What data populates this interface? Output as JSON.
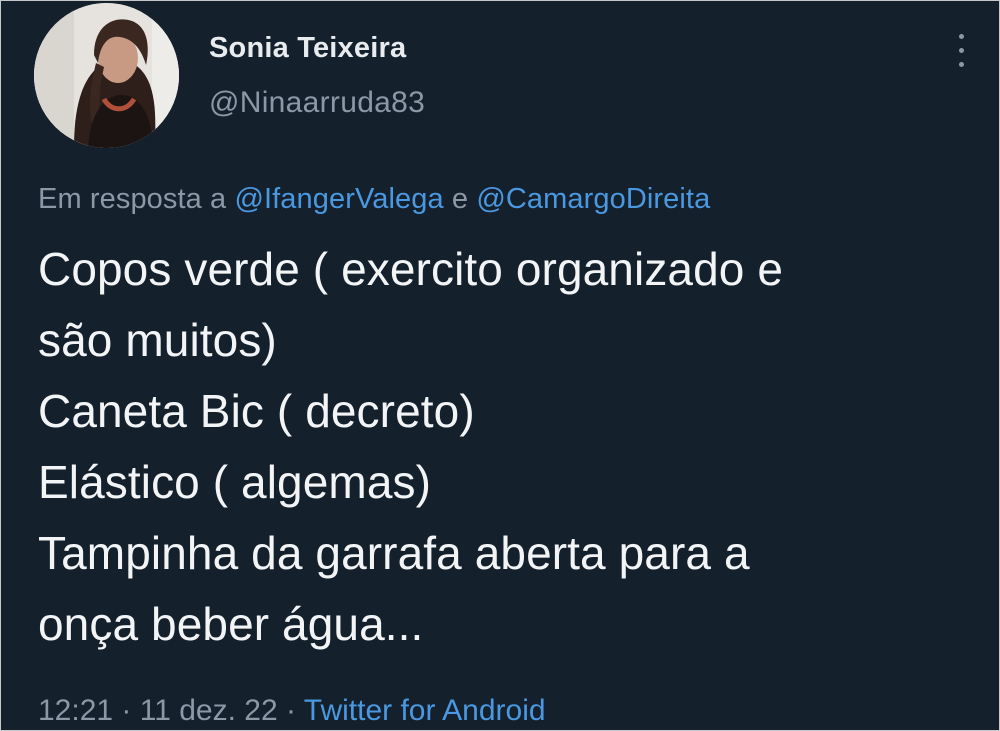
{
  "tweet": {
    "author": {
      "display_name": "Sonia Teixeira",
      "handle": "@Ninaarruda83"
    },
    "reply_to": {
      "prefix": "Em resposta a",
      "mention_1": "@IfangerValega",
      "joiner": "e",
      "mention_2": "@CamargoDireita"
    },
    "text_lines": [
      "Copos verde ( exercito organizado e",
      "são muitos)",
      "Caneta Bic ( decreto)",
      "Elástico ( algemas)",
      "Tampinha da garrafa aberta para a",
      "onça beber água..."
    ],
    "time": "12:21",
    "separator": "·",
    "date": "11 dez. 22",
    "source": "Twitter for Android"
  },
  "icons": {
    "more": "more-vertical-icon",
    "avatar": "avatar-photo"
  },
  "colors": {
    "background": "#14202c",
    "primary_text": "#f2f4f6",
    "secondary_text": "#8b98a5",
    "link": "#4a98e0"
  }
}
